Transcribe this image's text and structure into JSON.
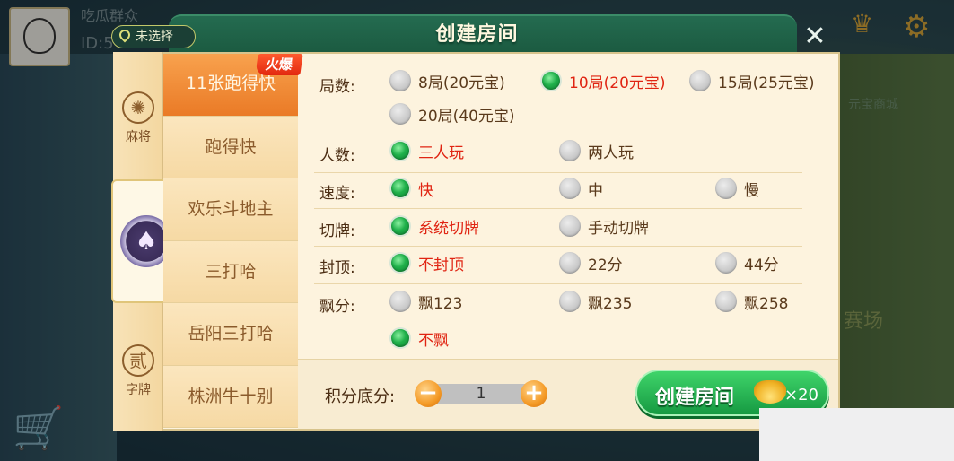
{
  "dialog": {
    "title": "创建房间"
  },
  "location": {
    "label": "未选择"
  },
  "background": {
    "name": "吃瓜群众",
    "id": "ID:5",
    "yuanbao_shop": "元宝商城",
    "field_label": "赛场"
  },
  "categories": [
    {
      "label": "麻将",
      "icon": "mahjong-icon"
    },
    {
      "label": "",
      "icon": "poker-spade-icon"
    },
    {
      "label": "字牌",
      "icon": "zipai-icon",
      "glyph": "贰"
    }
  ],
  "hot_badge": "火爆",
  "games": [
    "11张跑得快",
    "跑得快",
    "欢乐斗地主",
    "三打哈",
    "岳阳三打哈",
    "株洲牛十别"
  ],
  "rules": {
    "rounds": {
      "label": "局数:",
      "options": [
        "8局(20元宝)",
        "10局(20元宝)",
        "15局(25元宝)",
        "20局(40元宝)"
      ],
      "selected": 1
    },
    "players": {
      "label": "人数:",
      "options": [
        "三人玩",
        "两人玩"
      ],
      "selected": 0
    },
    "speed": {
      "label": "速度:",
      "options": [
        "快",
        "中",
        "慢"
      ],
      "selected": 0
    },
    "shuffle": {
      "label": "切牌:",
      "options": [
        "系统切牌",
        "手动切牌"
      ],
      "selected": 0
    },
    "cap": {
      "label": "封顶:",
      "options": [
        "不封顶",
        "22分",
        "44分"
      ],
      "selected": 0
    },
    "float": {
      "label": "飘分:",
      "options": [
        "飘123",
        "飘235",
        "飘258",
        "不飘"
      ],
      "selected": 3
    }
  },
  "footer": {
    "score_label": "积分底分:",
    "score_value": "1",
    "minus": "−",
    "plus": "+",
    "create_label": "创建房间",
    "cost": "×20"
  },
  "colors": {
    "selected_text": "#e02412",
    "accent_green": "#1fb04a",
    "active_tab": "#ea7a26"
  }
}
